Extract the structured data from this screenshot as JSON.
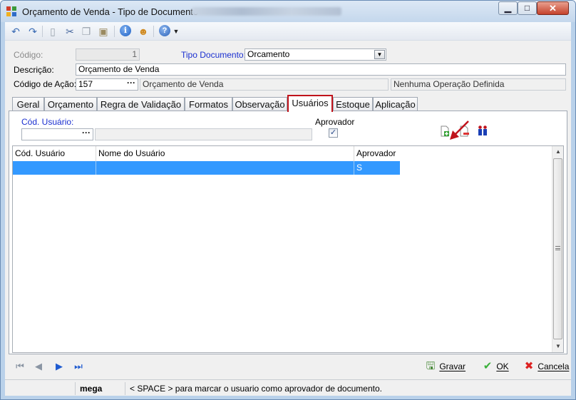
{
  "window": {
    "title": "Orçamento de Venda -  Tipo de Documento",
    "minimize_glyph": "▁",
    "maximize_glyph": "□",
    "close_glyph": "✕"
  },
  "toolbar": {
    "icons": [
      "undo-icon",
      "redo-icon",
      "new-document-icon",
      "cut-icon",
      "copy-icon",
      "paste-icon",
      "info-icon",
      "user-icon",
      "help-icon",
      "dropdown-arrow-icon"
    ],
    "undo_glyph": "↶",
    "redo_glyph": "↷",
    "new_glyph": "▯",
    "cut_glyph": "✂",
    "copy_glyph": "❐",
    "paste_glyph": "▣",
    "info_glyph": "i",
    "user_glyph": "☻",
    "help_glyph": "?",
    "dd_glyph": "▼"
  },
  "form": {
    "codigo_label": "Código:",
    "codigo_value": "1",
    "tipo_documento_label": "Tipo Documento:",
    "tipo_documento_value": "Orcamento",
    "descricao_label": "Descrição:",
    "descricao_value": "Orçamento de Venda",
    "codigo_acao_label": "Código de Ação:",
    "codigo_acao_value": "157",
    "acao_nome": "Orçamento de Venda",
    "operacao": "Nenhuma Operação Definida",
    "ellipsis": "···",
    "drop_glyph": "▼"
  },
  "tabs": [
    {
      "label": "Geral"
    },
    {
      "label": "Orçamento"
    },
    {
      "label": "Regra de Validação"
    },
    {
      "label": "Formatos"
    },
    {
      "label": "Observação"
    },
    {
      "label": "Usuários"
    },
    {
      "label": "Estoque"
    },
    {
      "label": "Aplicação"
    }
  ],
  "active_tab": "Usuários",
  "usuarios": {
    "cod_usuario_label": "Cód. Usuário:",
    "cod_usuario_value": "",
    "nome_usuario_value": "",
    "aprovador_label": "Aprovador",
    "aprovador_checked": true,
    "check_glyph": "✓",
    "action_icons": [
      "add-document-icon",
      "remove-document-icon",
      "users-icon"
    ]
  },
  "grid": {
    "columns": [
      "Cód. Usuário",
      "Nome do Usuário",
      "Aprovador"
    ],
    "rows": [
      {
        "cod": "",
        "nome": "",
        "aprovador": "S"
      }
    ],
    "scroll_up": "▲",
    "scroll_down": "▼"
  },
  "nav": {
    "first_glyph": "⏮",
    "prev_glyph": "◀",
    "next_glyph": "▶",
    "last_glyph": "⏭"
  },
  "actions": {
    "gravar": "Gravar",
    "ok": "OK",
    "cancela": "Cancela",
    "gravar_glyph": "🖫",
    "ok_glyph": "✔",
    "cancela_glyph": "✖"
  },
  "status": {
    "user": "mega",
    "message": "< SPACE > para marcar o usuario como aprovador de documento."
  },
  "colors": {
    "selection": "#3399ff",
    "active_tab_border": "#c0131b",
    "annotation_arrow": "#c0131b",
    "label_blue": "#1a2fd0"
  }
}
